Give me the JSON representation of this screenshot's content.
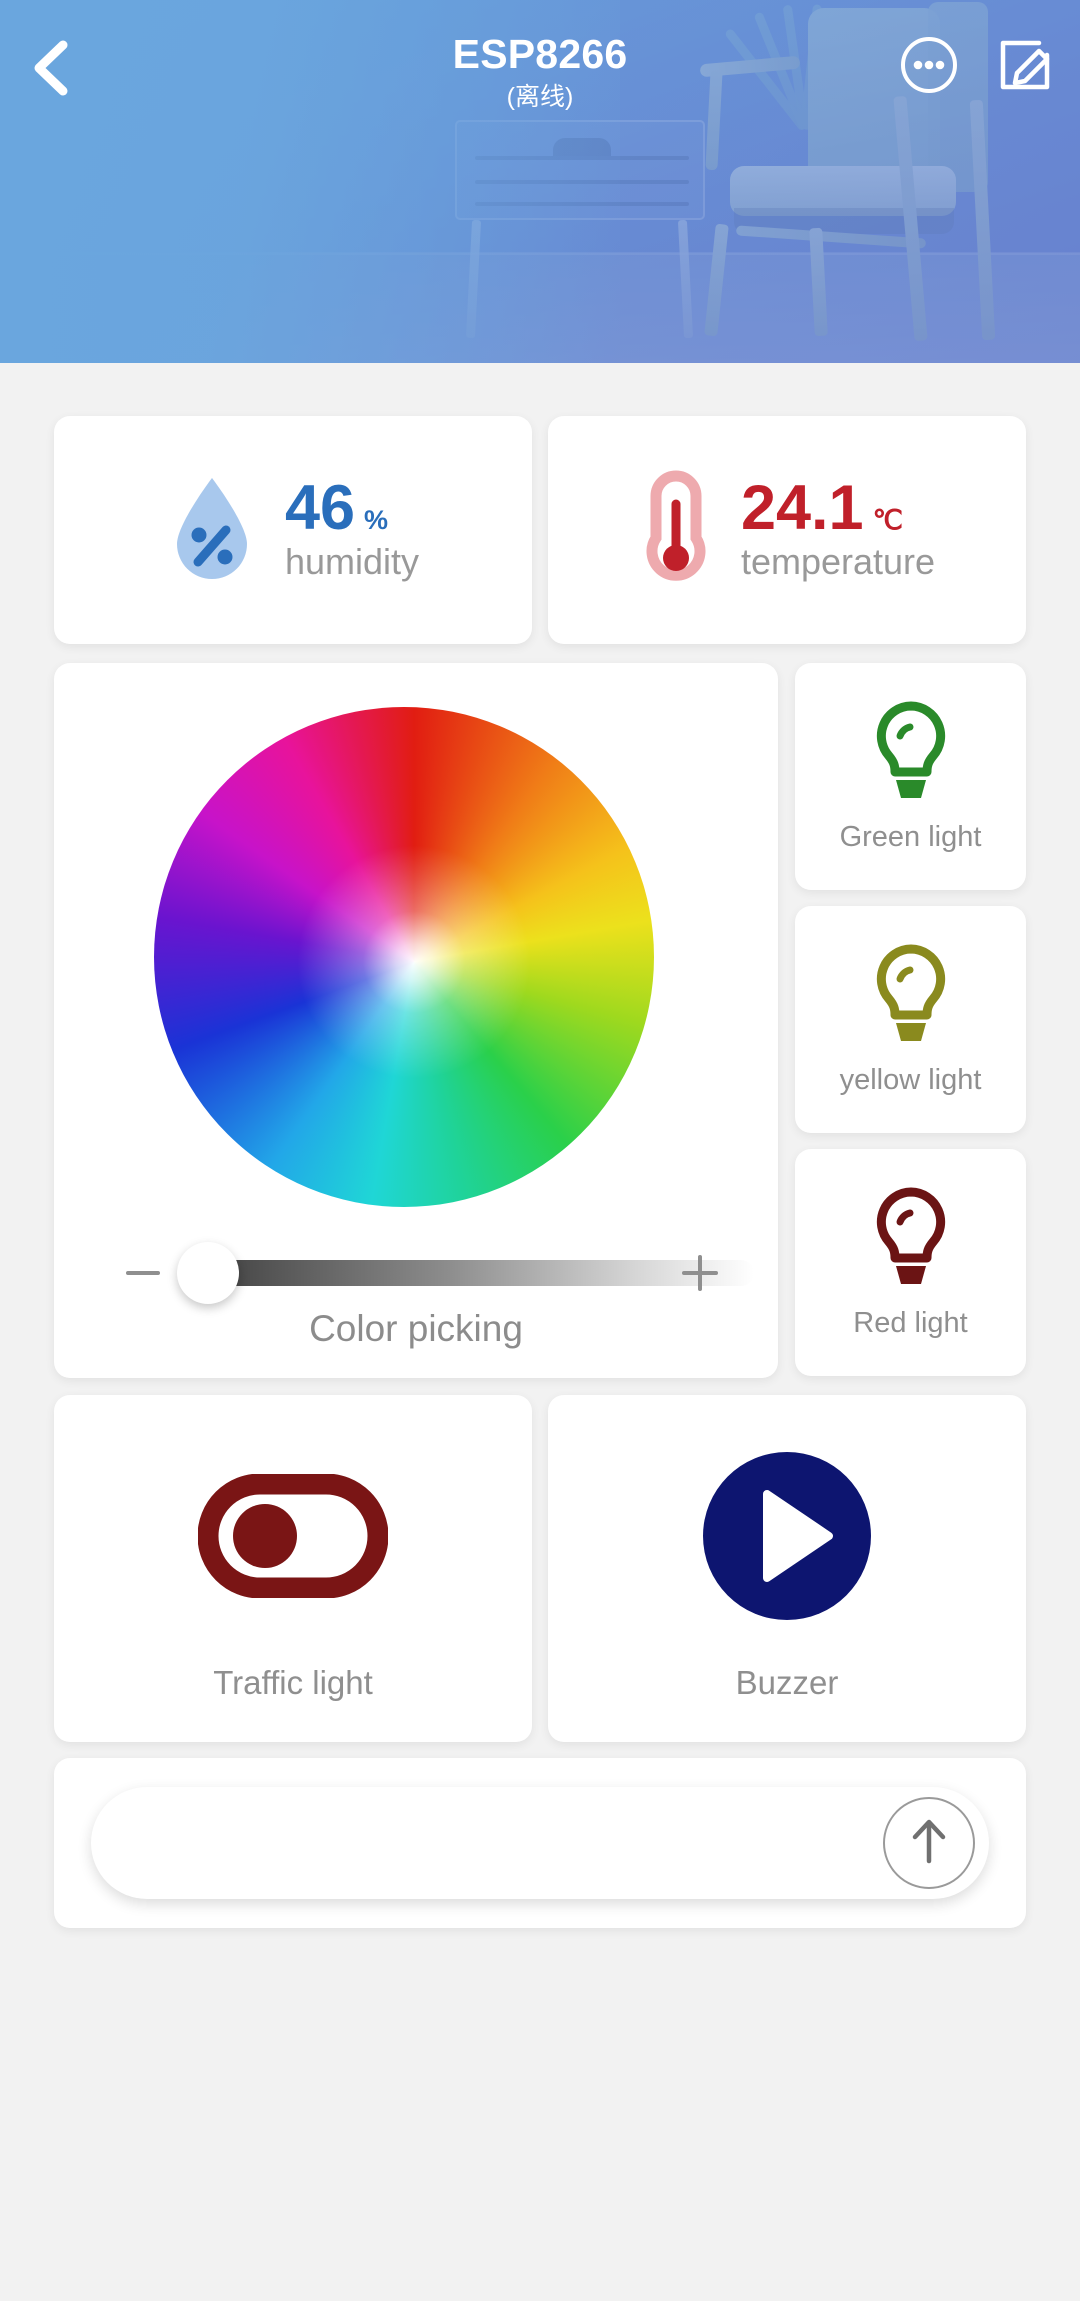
{
  "header": {
    "title": "ESP8266",
    "status": "(离线)",
    "back_icon": "chevron-left-icon",
    "more_icon": "more-options-icon",
    "edit_icon": "edit-pencil-icon",
    "gradient_from": "#6aa6de",
    "gradient_to": "#6a7fcd"
  },
  "sensors": [
    {
      "icon": "humidity-droplet-icon",
      "value": "46",
      "unit": "%",
      "label": "humidity",
      "color": "#2a6ebb",
      "icon_fill": "#a8c8ed"
    },
    {
      "icon": "thermometer-icon",
      "value": "24.1",
      "unit": "℃",
      "label": "temperature",
      "color": "#c0202a",
      "icon_fill": "#eeaaae"
    }
  ],
  "color_picker": {
    "caption": "Color picking",
    "minus_icon": "minus-icon",
    "plus_icon": "plus-icon",
    "wheel_icon": "color-wheel",
    "slider_value": 0
  },
  "lights": [
    {
      "label": "Green light",
      "icon": "lightbulb-icon",
      "color": "#2a8a2a"
    },
    {
      "label": "yellow light",
      "icon": "lightbulb-icon",
      "color": "#8a8a1e"
    },
    {
      "label": "Red light",
      "icon": "lightbulb-icon",
      "color": "#6b1414"
    }
  ],
  "devices": [
    {
      "label": "Traffic light",
      "icon": "toggle-switch-off-icon",
      "color": "#7a1515"
    },
    {
      "label": "Buzzer",
      "icon": "play-circle-icon",
      "color": "#0d1570"
    }
  ],
  "command_bar": {
    "value": "",
    "placeholder": "",
    "send_icon": "arrow-up-icon"
  },
  "theme": {
    "page_background": "#f2f2f2",
    "card_background": "#ffffff",
    "muted_text": "#8f8f8f"
  }
}
